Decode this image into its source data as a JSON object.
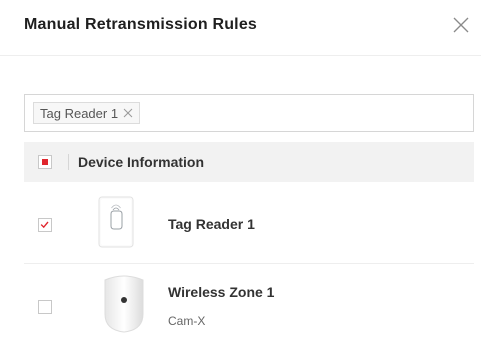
{
  "dialog": {
    "title": "Manual Retransmission Rules",
    "close_icon": "close-icon"
  },
  "selected": {
    "tags": [
      {
        "label": "Tag Reader 1",
        "remove_icon": "close-icon"
      }
    ]
  },
  "table": {
    "header": {
      "label": "Device Information",
      "select_all_state": "indeterminate"
    },
    "rows": [
      {
        "name": "Tag Reader 1",
        "subtitle": "",
        "checked": true,
        "icon": "tag-reader-icon"
      },
      {
        "name": "Wireless Zone 1",
        "subtitle": "Cam-X",
        "checked": false,
        "icon": "pir-camera-detector-icon"
      }
    ]
  },
  "colors": {
    "accent": "#e0262e",
    "header_bg": "#f2f2f2",
    "divider": "#eeeeee"
  }
}
